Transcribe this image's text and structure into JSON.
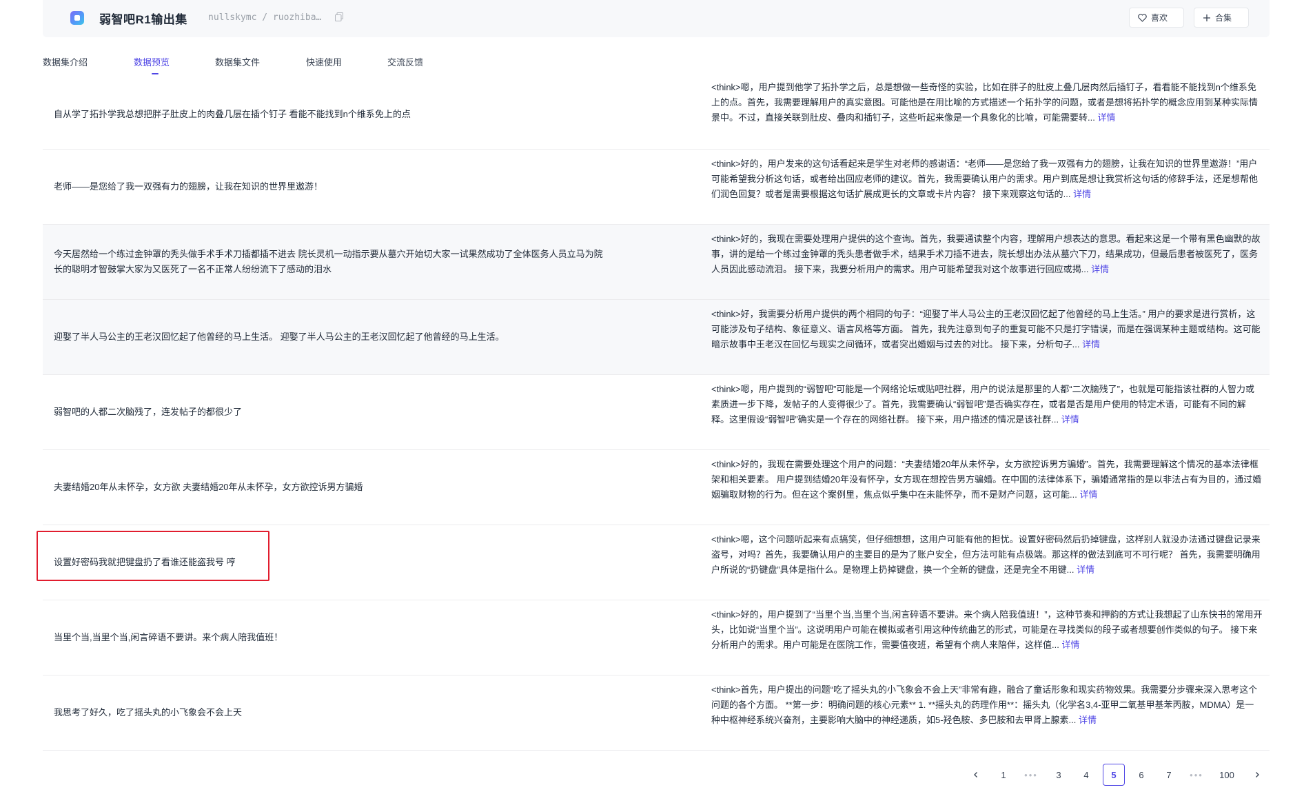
{
  "header": {
    "title": "弱智吧R1输出集",
    "path": "nullskymc / ruozhiba…",
    "like_label": "喜欢",
    "collect_label": "合集"
  },
  "tabs": [
    {
      "label": "数据集介绍",
      "active": false
    },
    {
      "label": "数据预览",
      "active": true
    },
    {
      "label": "数据集文件",
      "active": false
    },
    {
      "label": "快速使用",
      "active": false
    },
    {
      "label": "交流反馈",
      "active": false
    }
  ],
  "detail_label": "详情",
  "rows": [
    {
      "instruction": "自从学了拓扑学我总想把胖子肚皮上的肉叠几层在插个钉子 看能不能找到n个维系免上的点",
      "output": "<think>嗯，用户提到他学了拓扑学之后，总是想做一些奇怪的实验，比如在胖子的肚皮上叠几层肉然后插钉子，看看能不能找到n个维系免上的点。首先，我需要理解用户的真实意图。可能他是在用比喻的方式描述一个拓扑学的问题，或者是想将拓扑学的概念应用到某种实际情景中。不过，直接关联到肚皮、叠肉和插钉子，这些听起来像是一个具象化的比喻，可能需要转..."
    },
    {
      "instruction": "老师——是您给了我一双强有力的翅膀，让我在知识的世界里遨游！",
      "output": "<think>好的，用户发来的这句话看起来是学生对老师的感谢语：“老师——是您给了我一双强有力的翅膀，让我在知识的世界里遨游！”用户可能希望我分析这句话，或者给出回应老师的建议。首先，我需要确认用户的需求。用户到底是想让我赏析这句话的修辞手法，还是想帮他们润色回复？或者是需要根据这句话扩展成更长的文章或卡片内容？ 接下来观察这句话的..."
    },
    {
      "instruction": "今天居然给一个练过金钟罩的秃头做手术手术刀插都插不进去 院长灵机一动指示要从墓穴开始切大家一试果然成功了全体医务人员立马为院长的聪明才智鼓掌大家为又医死了一名不正常人纷纷流下了感动的泪水",
      "output": "<think>好的，我现在需要处理用户提供的这个查询。首先，我要通读整个内容，理解用户想表达的意思。看起来这是一个带有黑色幽默的故事，讲的是给一个练过金钟罩的秃头患者做手术，结果手术刀插不进去，院长想出办法从墓穴下刀，结果成功，但最后患者被医死了，医务人员因此感动流泪。 接下来，我要分析用户的需求。用户可能希望我对这个故事进行回应或揭..."
    },
    {
      "instruction": "迎娶了半人马公主的王老汉回忆起了他曾经的马上生活。 迎娶了半人马公主的王老汉回忆起了他曾经的马上生活。",
      "output": "<think>好，我需要分析用户提供的两个相同的句子：“迎娶了半人马公主的王老汉回忆起了他曾经的马上生活。” 用户的要求是进行赏析，这可能涉及句子结构、象征意义、语言风格等方面。 首先，我先注意到句子的重复可能不只是打字错误，而是在强调某种主题或结构。这可能暗示故事中王老汉在回忆与现实之间循环，或者突出婚姻与过去的对比。 接下来，分析句子..."
    },
    {
      "instruction": "弱智吧的人都二次脑残了，连发帖子的都很少了",
      "output": "<think>嗯，用户提到的“弱智吧”可能是一个网络论坛或贴吧社群，用户的说法是那里的人都“二次脑残了”，也就是可能指该社群的人智力或素质进一步下降，发帖子的人变得很少了。首先，我需要确认“弱智吧”是否确实存在，或者是否是用户使用的特定术语，可能有不同的解释。这里假设“弱智吧”确实是一个存在的网络社群。 接下来，用户描述的情况是该社群..."
    },
    {
      "instruction": "夫妻结婚20年从未怀孕，女方欲 夫妻结婚20年从未怀孕，女方欲控诉男方骗婚",
      "output": "<think>好的，我现在需要处理这个用户的问题：“夫妻结婚20年从未怀孕，女方欲控诉男方骗婚”。首先，我需要理解这个情况的基本法律框架和相关要素。 用户提到结婚20年没有怀孕，女方现在想控告男方骗婚。在中国的法律体系下，骗婚通常指的是以非法占有为目的，通过婚姻骗取财物的行为。但在这个案例里，焦点似乎集中在未能怀孕，而不是财产问题，这可能..."
    },
    {
      "instruction": "设置好密码我就把键盘扔了看谁还能盗我号 哼",
      "output": "<think>嗯，这个问题听起来有点搞笑，但仔细想想，这用户可能有他的担忧。设置好密码然后扔掉键盘，这样别人就没办法通过键盘记录来盗号，对吗？首先，我要确认用户的主要目的是为了账户安全，但方法可能有点极端。那这样的做法到底可不可行呢？ 首先，我需要明确用户所说的“扔键盘”具体是指什么。是物理上扔掉键盘，换一个全新的键盘，还是完全不用键..."
    },
    {
      "instruction": "当里个当,当里个当,闲言碎语不要讲。来个病人陪我值班！",
      "output": "<think>好的，用户提到了“当里个当,当里个当,闲言碎语不要讲。来个病人陪我值班！”，这种节奏和押韵的方式让我想起了山东快书的常用开头，比如说“当里个当”。这说明用户可能在模拟或者引用这种传统曲艺的形式，可能是在寻找类似的段子或者想要创作类似的句子。 接下来分析用户的需求。用户可能是在医院工作，需要值夜班，希望有个病人来陪伴，这样值..."
    },
    {
      "instruction": "我思考了好久，吃了摇头丸的小飞象会不会上天",
      "output": "<think>首先，用户提出的问题“吃了摇头丸的小飞象会不会上天”非常有趣，融合了童话形象和现实药物效果。我需要分步骤来深入思考这个问题的各个方面。 **第一步：明确问题的核心元素** 1. **摇头丸的药理作用**：摇头丸（化学名3,4-亚甲二氧基甲基苯丙胺，MDMA）是一种中枢神经系统兴奋剂，主要影响大脑中的神经递质，如5-羟色胺、多巴胺和去甲肾上腺素..."
    }
  ],
  "pagination": {
    "pages": [
      "1",
      "•••",
      "3",
      "4",
      "5",
      "6",
      "7",
      "•••",
      "100"
    ],
    "current": "5"
  }
}
